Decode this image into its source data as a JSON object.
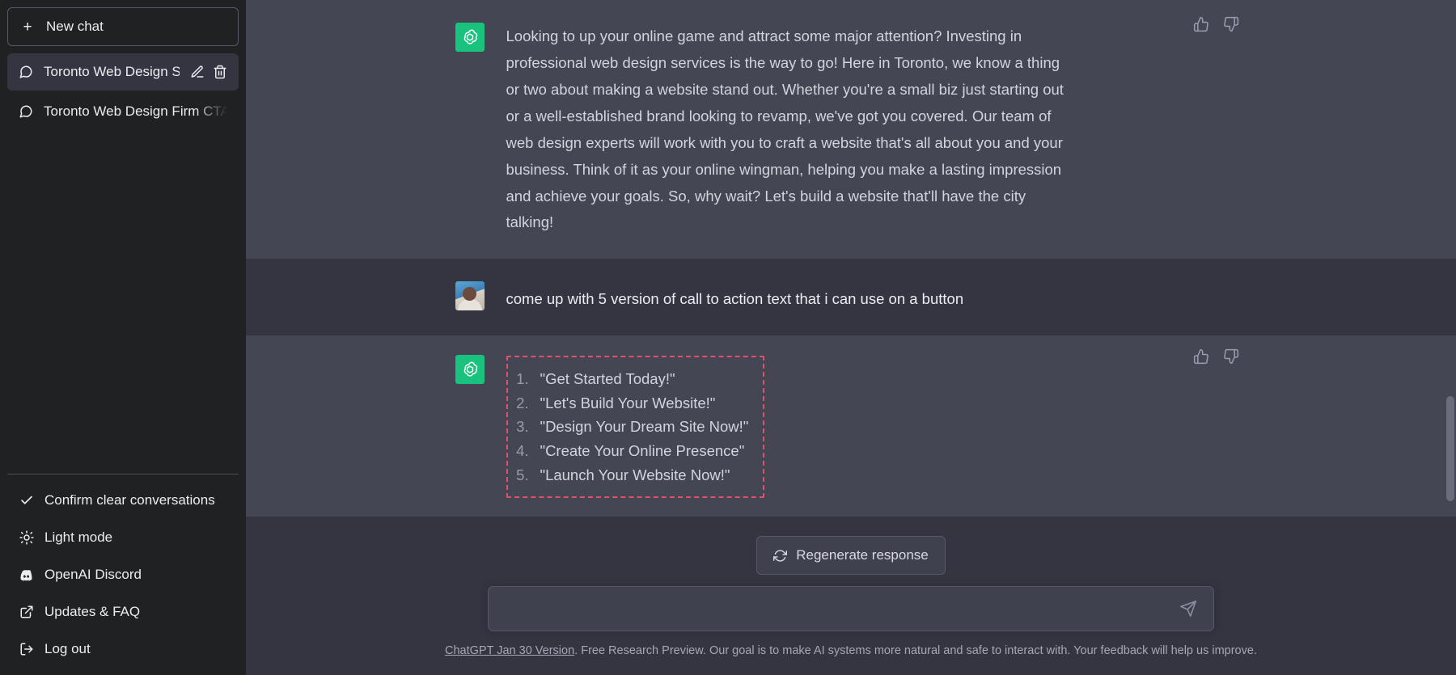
{
  "sidebar": {
    "new_chat_label": "New chat",
    "new_chat_icon": "plus-icon",
    "conversations": [
      {
        "title": "Toronto Web Design Sl",
        "icon": "message-icon",
        "active": true,
        "edit_icon": "pencil-icon",
        "delete_icon": "trash-icon"
      },
      {
        "title": "Toronto Web Design Firm CTA",
        "icon": "message-icon",
        "active": false
      }
    ],
    "footer_items": [
      {
        "label": "Confirm clear conversations",
        "icon": "check-icon"
      },
      {
        "label": "Light mode",
        "icon": "sun-icon"
      },
      {
        "label": "OpenAI Discord",
        "icon": "discord-icon"
      },
      {
        "label": "Updates & FAQ",
        "icon": "external-link-icon"
      },
      {
        "label": "Log out",
        "icon": "logout-icon"
      }
    ]
  },
  "thread": {
    "messages": [
      {
        "role": "assistant",
        "avatar_icon": "chatgpt-logo",
        "text": "Looking to up your online game and attract some major attention? Investing in professional web design services is the way to go! Here in Toronto, we know a thing or two about making a website stand out. Whether you're a small biz just starting out or a well-established brand looking to revamp, we've got you covered. Our team of web design experts will work with you to craft a website that's all about you and your business. Think of it as your online wingman, helping you make a lasting impression and achieve your goals. So, why wait? Let's build a website that'll have the city talking!",
        "thumbs_up_icon": "thumbs-up-icon",
        "thumbs_down_icon": "thumbs-down-icon"
      },
      {
        "role": "user",
        "avatar_icon": "user-avatar",
        "text": "come up with 5 version of call to action text that i can use on a button"
      },
      {
        "role": "assistant",
        "avatar_icon": "chatgpt-logo",
        "list_selected": true,
        "list": [
          "\"Get Started Today!\"",
          "\"Let's Build Your Website!\"",
          "\"Design Your Dream Site Now!\"",
          "\"Create Your Online Presence\"",
          "\"Launch Your Website Now!\""
        ],
        "thumbs_up_icon": "thumbs-up-icon",
        "thumbs_down_icon": "thumbs-down-icon"
      }
    ]
  },
  "composer": {
    "regenerate_label": "Regenerate response",
    "regenerate_icon": "refresh-icon",
    "input_value": "",
    "input_placeholder": "",
    "send_icon": "send-icon"
  },
  "footer": {
    "version_link": "ChatGPT Jan 30 Version",
    "disclaimer": ". Free Research Preview. Our goal is to make AI systems more natural and safe to interact with. Your feedback will help us improve."
  },
  "colors": {
    "sidebar_bg": "#202123",
    "assistant_row_bg": "#444654",
    "user_row_bg": "#343541",
    "accent_green": "#19c37d",
    "selection_red": "#e0526b"
  }
}
